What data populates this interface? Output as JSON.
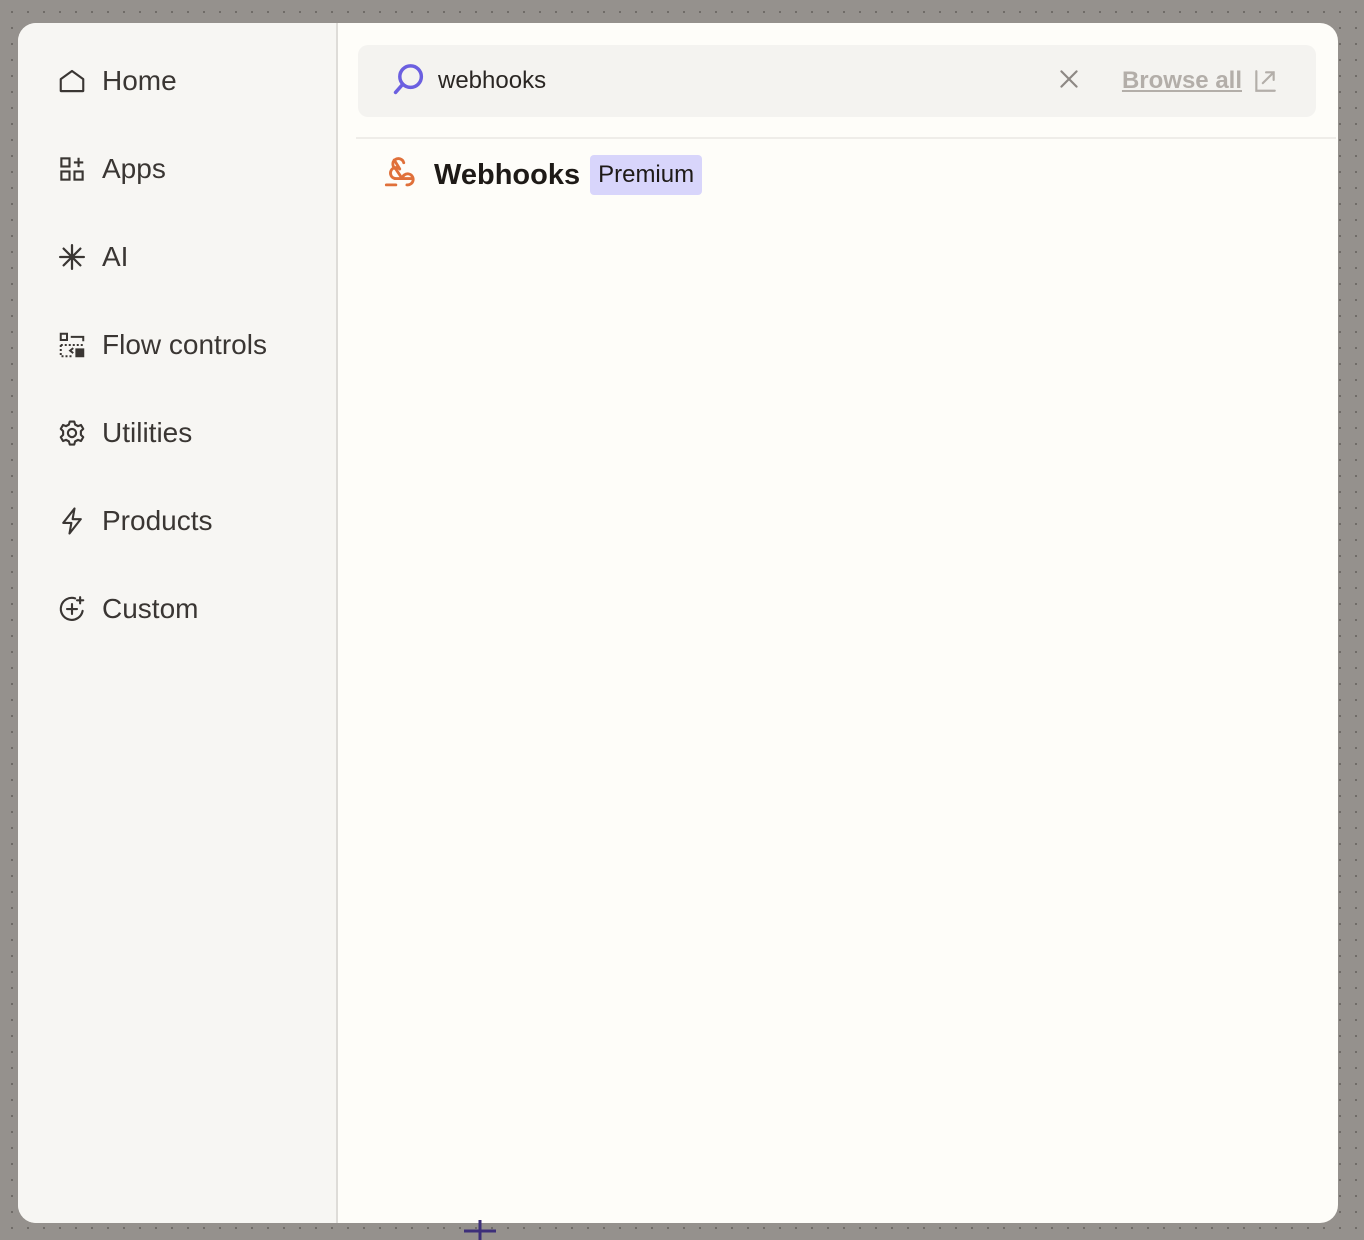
{
  "sidebar": {
    "items": [
      {
        "label": "Home",
        "icon": "home-icon"
      },
      {
        "label": "Apps",
        "icon": "apps-grid-icon"
      },
      {
        "label": "AI",
        "icon": "sparkle-icon"
      },
      {
        "label": "Flow controls",
        "icon": "flow-controls-icon"
      },
      {
        "label": "Utilities",
        "icon": "gear-icon"
      },
      {
        "label": "Products",
        "icon": "lightning-icon"
      },
      {
        "label": "Custom",
        "icon": "custom-plus-icon"
      }
    ]
  },
  "search": {
    "value": "webhooks",
    "clear_icon": "close-icon",
    "browse_all_label": "Browse all",
    "browse_icon": "external-link-icon"
  },
  "results": [
    {
      "title": "Webhooks",
      "badge": "Premium",
      "icon": "webhooks-icon"
    }
  ],
  "colors": {
    "accent": "#6b5fe0",
    "webhook_orange": "#e0703a",
    "badge_bg": "#d8d5fb",
    "backdrop": "#95918d"
  }
}
